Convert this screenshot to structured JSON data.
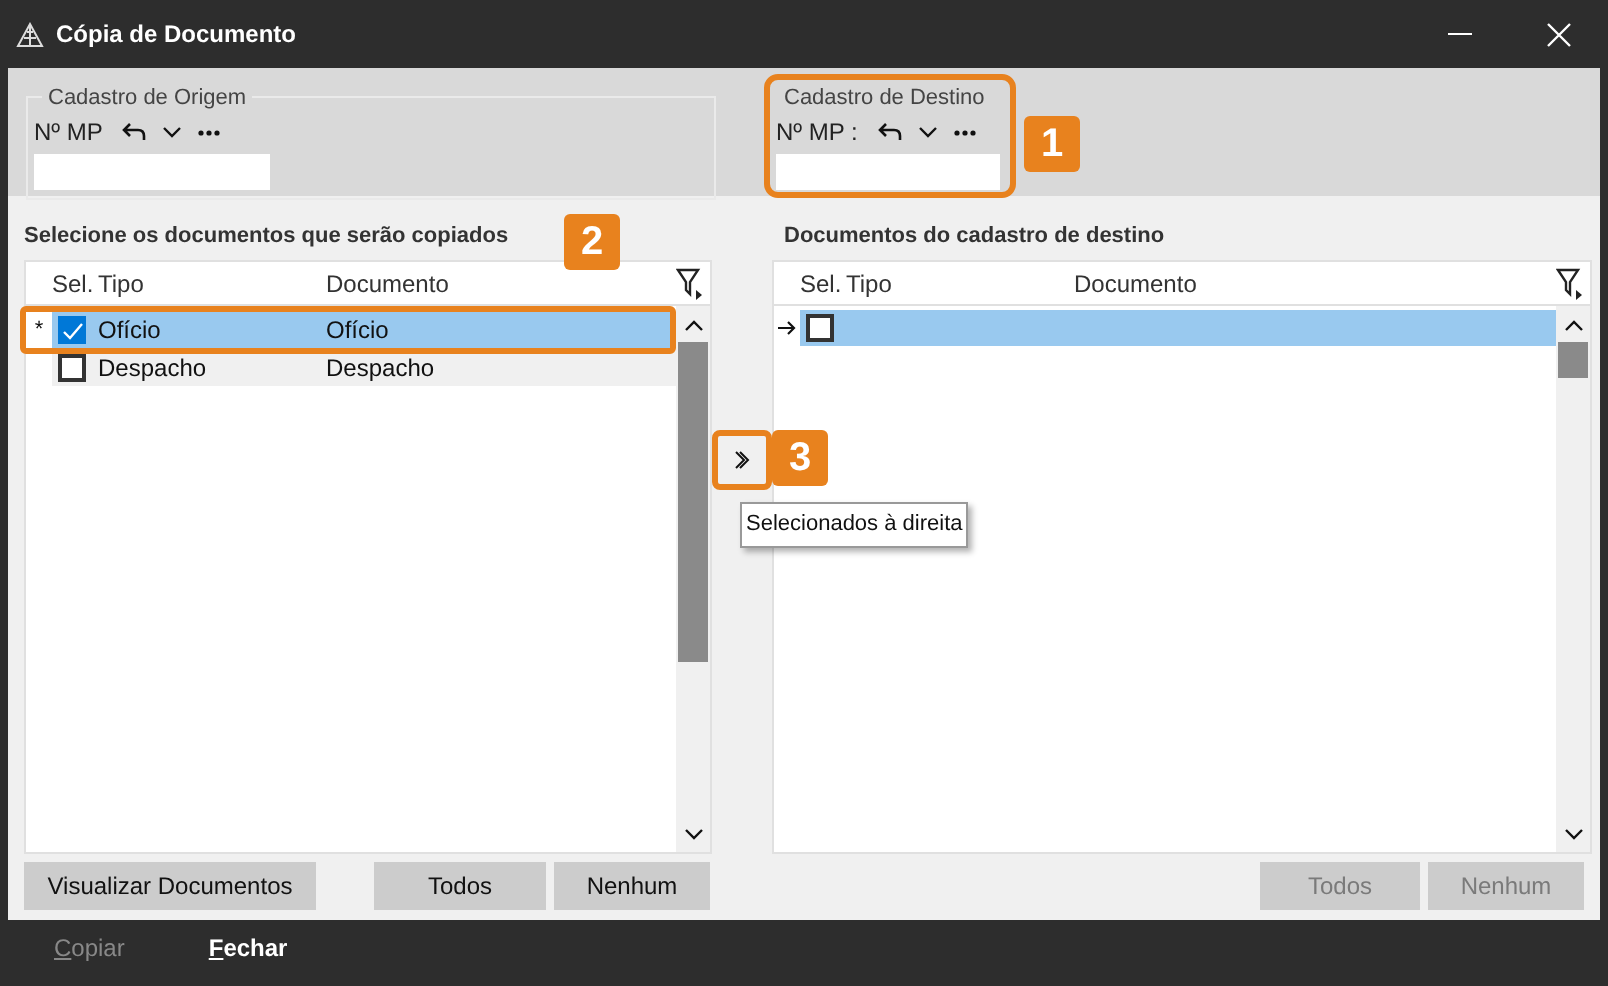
{
  "window": {
    "title": "Cópia de Documento"
  },
  "origin": {
    "legend": "Cadastro de Origem",
    "label": "Nº MP"
  },
  "destination": {
    "legend": "Cadastro de Destino",
    "label": "Nº MP :"
  },
  "source_grid": {
    "title": "Selecione os documentos que serão copiados",
    "columns": [
      "Sel.",
      "Tipo",
      "Documento"
    ],
    "rows": [
      {
        "marker": "*",
        "checked": true,
        "selected": true,
        "tipo": "Ofício",
        "documento": "Ofício"
      },
      {
        "checked": false,
        "selected": false,
        "tipo": "Despacho",
        "documento": "Despacho"
      }
    ],
    "buttons": [
      {
        "label": "Visualizar Documentos",
        "disabled": false
      },
      {
        "label": "Todos",
        "disabled": false
      },
      {
        "label": "Nenhum",
        "disabled": false
      }
    ]
  },
  "move_button": {
    "tooltip": "Selecionados à direita"
  },
  "target_grid": {
    "title": "Documentos do cadastro de destino",
    "columns": [
      "Sel.",
      "Tipo",
      "Documento"
    ],
    "rows": [
      {
        "current": true,
        "checked": false,
        "selected": true
      }
    ],
    "buttons": [
      {
        "label": "Todos",
        "disabled": true
      },
      {
        "label": "Nenhum",
        "disabled": true
      }
    ]
  },
  "callouts": [
    "1",
    "2",
    "3"
  ],
  "footer": {
    "buttons": [
      {
        "label": "Copiar",
        "disabled": true
      },
      {
        "label": "Fechar",
        "disabled": false
      }
    ]
  }
}
